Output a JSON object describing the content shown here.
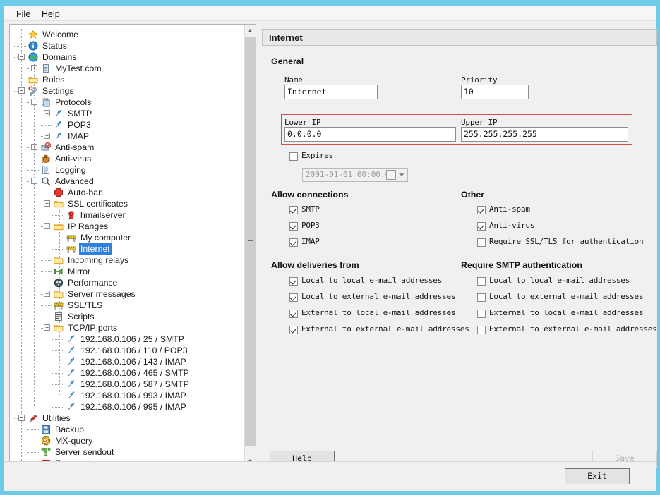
{
  "window": {
    "accent_color": "#6ecbe8",
    "menu": [
      {
        "label": "File",
        "name": "menu-file"
      },
      {
        "label": "Help",
        "name": "menu-help"
      }
    ]
  },
  "tree": {
    "selected": "Internet",
    "nodes": [
      {
        "label": "Welcome",
        "depth": 1,
        "icon": "star-icon",
        "expander": ""
      },
      {
        "label": "Status",
        "depth": 1,
        "icon": "info-icon",
        "expander": ""
      },
      {
        "label": "Domains",
        "depth": 1,
        "icon": "globe-icon",
        "expander": "-"
      },
      {
        "label": "MyTest.com",
        "depth": 2,
        "icon": "server-icon",
        "expander": "+"
      },
      {
        "label": "Rules",
        "depth": 1,
        "icon": "folder-icon",
        "expander": ""
      },
      {
        "label": "Settings",
        "depth": 1,
        "icon": "tools-icon",
        "expander": "-"
      },
      {
        "label": "Protocols",
        "depth": 2,
        "icon": "protocols-icon",
        "expander": "-"
      },
      {
        "label": "SMTP",
        "depth": 3,
        "icon": "plug-icon",
        "expander": "+"
      },
      {
        "label": "POP3",
        "depth": 3,
        "icon": "plug-icon",
        "expander": ""
      },
      {
        "label": "IMAP",
        "depth": 3,
        "icon": "plug-icon",
        "expander": "+"
      },
      {
        "label": "Anti-spam",
        "depth": 2,
        "icon": "antispam-icon",
        "expander": "+"
      },
      {
        "label": "Anti-virus",
        "depth": 2,
        "icon": "antivirus-icon",
        "expander": ""
      },
      {
        "label": "Logging",
        "depth": 2,
        "icon": "log-icon",
        "expander": ""
      },
      {
        "label": "Advanced",
        "depth": 2,
        "icon": "magnifier-icon",
        "expander": "-"
      },
      {
        "label": "Auto-ban",
        "depth": 3,
        "icon": "stopsign-icon",
        "expander": ""
      },
      {
        "label": "SSL certificates",
        "depth": 3,
        "icon": "folder-icon",
        "expander": "-"
      },
      {
        "label": "hmailserver",
        "depth": 4,
        "icon": "certificate-icon",
        "expander": ""
      },
      {
        "label": "IP Ranges",
        "depth": 3,
        "icon": "folder-icon",
        "expander": "-"
      },
      {
        "label": "My computer",
        "depth": 4,
        "icon": "barrier-icon",
        "expander": ""
      },
      {
        "label": "Internet",
        "depth": 4,
        "icon": "barrier-icon",
        "expander": ""
      },
      {
        "label": "Incoming relays",
        "depth": 3,
        "icon": "folder-icon",
        "expander": ""
      },
      {
        "label": "Mirror",
        "depth": 3,
        "icon": "mirror-icon",
        "expander": ""
      },
      {
        "label": "Performance",
        "depth": 3,
        "icon": "performance-icon",
        "expander": ""
      },
      {
        "label": "Server messages",
        "depth": 3,
        "icon": "folder-icon",
        "expander": "+"
      },
      {
        "label": "SSL/TLS",
        "depth": 3,
        "icon": "barrier-icon",
        "expander": ""
      },
      {
        "label": "Scripts",
        "depth": 3,
        "icon": "script-icon",
        "expander": ""
      },
      {
        "label": "TCP/IP ports",
        "depth": 3,
        "icon": "folder-icon",
        "expander": "-"
      },
      {
        "label": "192.168.0.106 / 25 / SMTP",
        "depth": 4,
        "icon": "plug-icon",
        "expander": ""
      },
      {
        "label": "192.168.0.106 / 110 / POP3",
        "depth": 4,
        "icon": "plug-icon",
        "expander": ""
      },
      {
        "label": "192.168.0.106 / 143 / IMAP",
        "depth": 4,
        "icon": "plug-icon",
        "expander": ""
      },
      {
        "label": "192.168.0.106 / 465 / SMTP",
        "depth": 4,
        "icon": "plug-icon",
        "expander": ""
      },
      {
        "label": "192.168.0.106 / 587 / SMTP",
        "depth": 4,
        "icon": "plug-icon",
        "expander": ""
      },
      {
        "label": "192.168.0.106 / 993 / IMAP",
        "depth": 4,
        "icon": "plug-icon",
        "expander": ""
      },
      {
        "label": "192.168.0.106 / 995 / IMAP",
        "depth": 4,
        "icon": "plug-icon",
        "expander": ""
      },
      {
        "label": "Utilities",
        "depth": 1,
        "icon": "utilities-icon",
        "expander": "-"
      },
      {
        "label": "Backup",
        "depth": 2,
        "icon": "diskette-icon",
        "expander": ""
      },
      {
        "label": "MX-query",
        "depth": 2,
        "icon": "compass-icon",
        "expander": ""
      },
      {
        "label": "Server sendout",
        "depth": 2,
        "icon": "sendout-icon",
        "expander": ""
      },
      {
        "label": "Diagnostics",
        "depth": 2,
        "icon": "heart-icon",
        "expander": ""
      }
    ]
  },
  "panel": {
    "title": "Internet",
    "general": {
      "title": "General",
      "name_label": "Name",
      "name_value": "Internet",
      "priority_label": "Priority",
      "priority_value": "10",
      "lower_ip_label": "Lower IP",
      "lower_ip_value": "0.0.0.0",
      "upper_ip_label": "Upper IP",
      "upper_ip_value": "255.255.255.255",
      "highlight_color": "#d05050",
      "expires_label": "Expires",
      "expires_checked": false,
      "expires_date_value": "2001-01-01 00:00:00"
    },
    "allow_connections": {
      "title": "Allow connections",
      "items": [
        {
          "label": "SMTP",
          "checked": true
        },
        {
          "label": "POP3",
          "checked": true
        },
        {
          "label": "IMAP",
          "checked": true
        }
      ]
    },
    "other": {
      "title": "Other",
      "items": [
        {
          "label": "Anti-spam",
          "checked": true
        },
        {
          "label": "Anti-virus",
          "checked": true
        },
        {
          "label": "Require SSL/TLS for authentication",
          "checked": false
        }
      ]
    },
    "allow_deliveries": {
      "title": "Allow deliveries from",
      "items": [
        {
          "label": "Local to local e-mail addresses",
          "checked": true
        },
        {
          "label": "Local to external e-mail addresses",
          "checked": true
        },
        {
          "label": "External to local e-mail addresses",
          "checked": true
        },
        {
          "label": "External to external e-mail addresses",
          "checked": true
        }
      ]
    },
    "require_smtp_auth": {
      "title": "Require SMTP authentication",
      "items": [
        {
          "label": "Local to local e-mail addresses",
          "checked": false
        },
        {
          "label": "Local to external e-mail addresses",
          "checked": false
        },
        {
          "label": "External to local e-mail addresses",
          "checked": false
        },
        {
          "label": "External to external e-mail addresses",
          "checked": false
        }
      ]
    },
    "buttons": {
      "help": "Help",
      "help_mnemonic": "H",
      "save": "Save",
      "save_enabled": false,
      "exit": "Exit"
    }
  }
}
